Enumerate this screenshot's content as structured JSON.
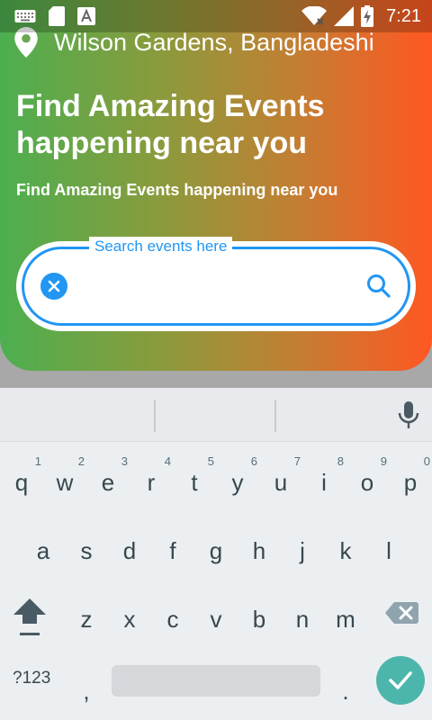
{
  "status_bar": {
    "time": "7:21",
    "icons": [
      "keyboard-icon",
      "sd-card-icon",
      "text-icon",
      "wifi-icon",
      "signal-icon",
      "battery-charging-icon"
    ]
  },
  "header": {
    "location": "Wilson Gardens, Bangladeshi",
    "title": "Find Amazing Events happening near you",
    "subtitle": "Find Amazing Events happening near you",
    "gradient": [
      "#4caf50",
      "#ff5722"
    ]
  },
  "search": {
    "label": "Search events here",
    "value": "",
    "accent": "#2196f3"
  },
  "keyboard": {
    "row1": [
      {
        "k": "q",
        "h": "1"
      },
      {
        "k": "w",
        "h": "2"
      },
      {
        "k": "e",
        "h": "3"
      },
      {
        "k": "r",
        "h": "4"
      },
      {
        "k": "t",
        "h": "5"
      },
      {
        "k": "y",
        "h": "6"
      },
      {
        "k": "u",
        "h": "7"
      },
      {
        "k": "i",
        "h": "8"
      },
      {
        "k": "o",
        "h": "9"
      },
      {
        "k": "p",
        "h": "0"
      }
    ],
    "row2": [
      "a",
      "s",
      "d",
      "f",
      "g",
      "h",
      "j",
      "k",
      "l"
    ],
    "row3": [
      "z",
      "x",
      "c",
      "v",
      "b",
      "n",
      "m"
    ],
    "symbols": "?123",
    "comma": ",",
    "period": ".",
    "done_color": "#4db6ac"
  }
}
